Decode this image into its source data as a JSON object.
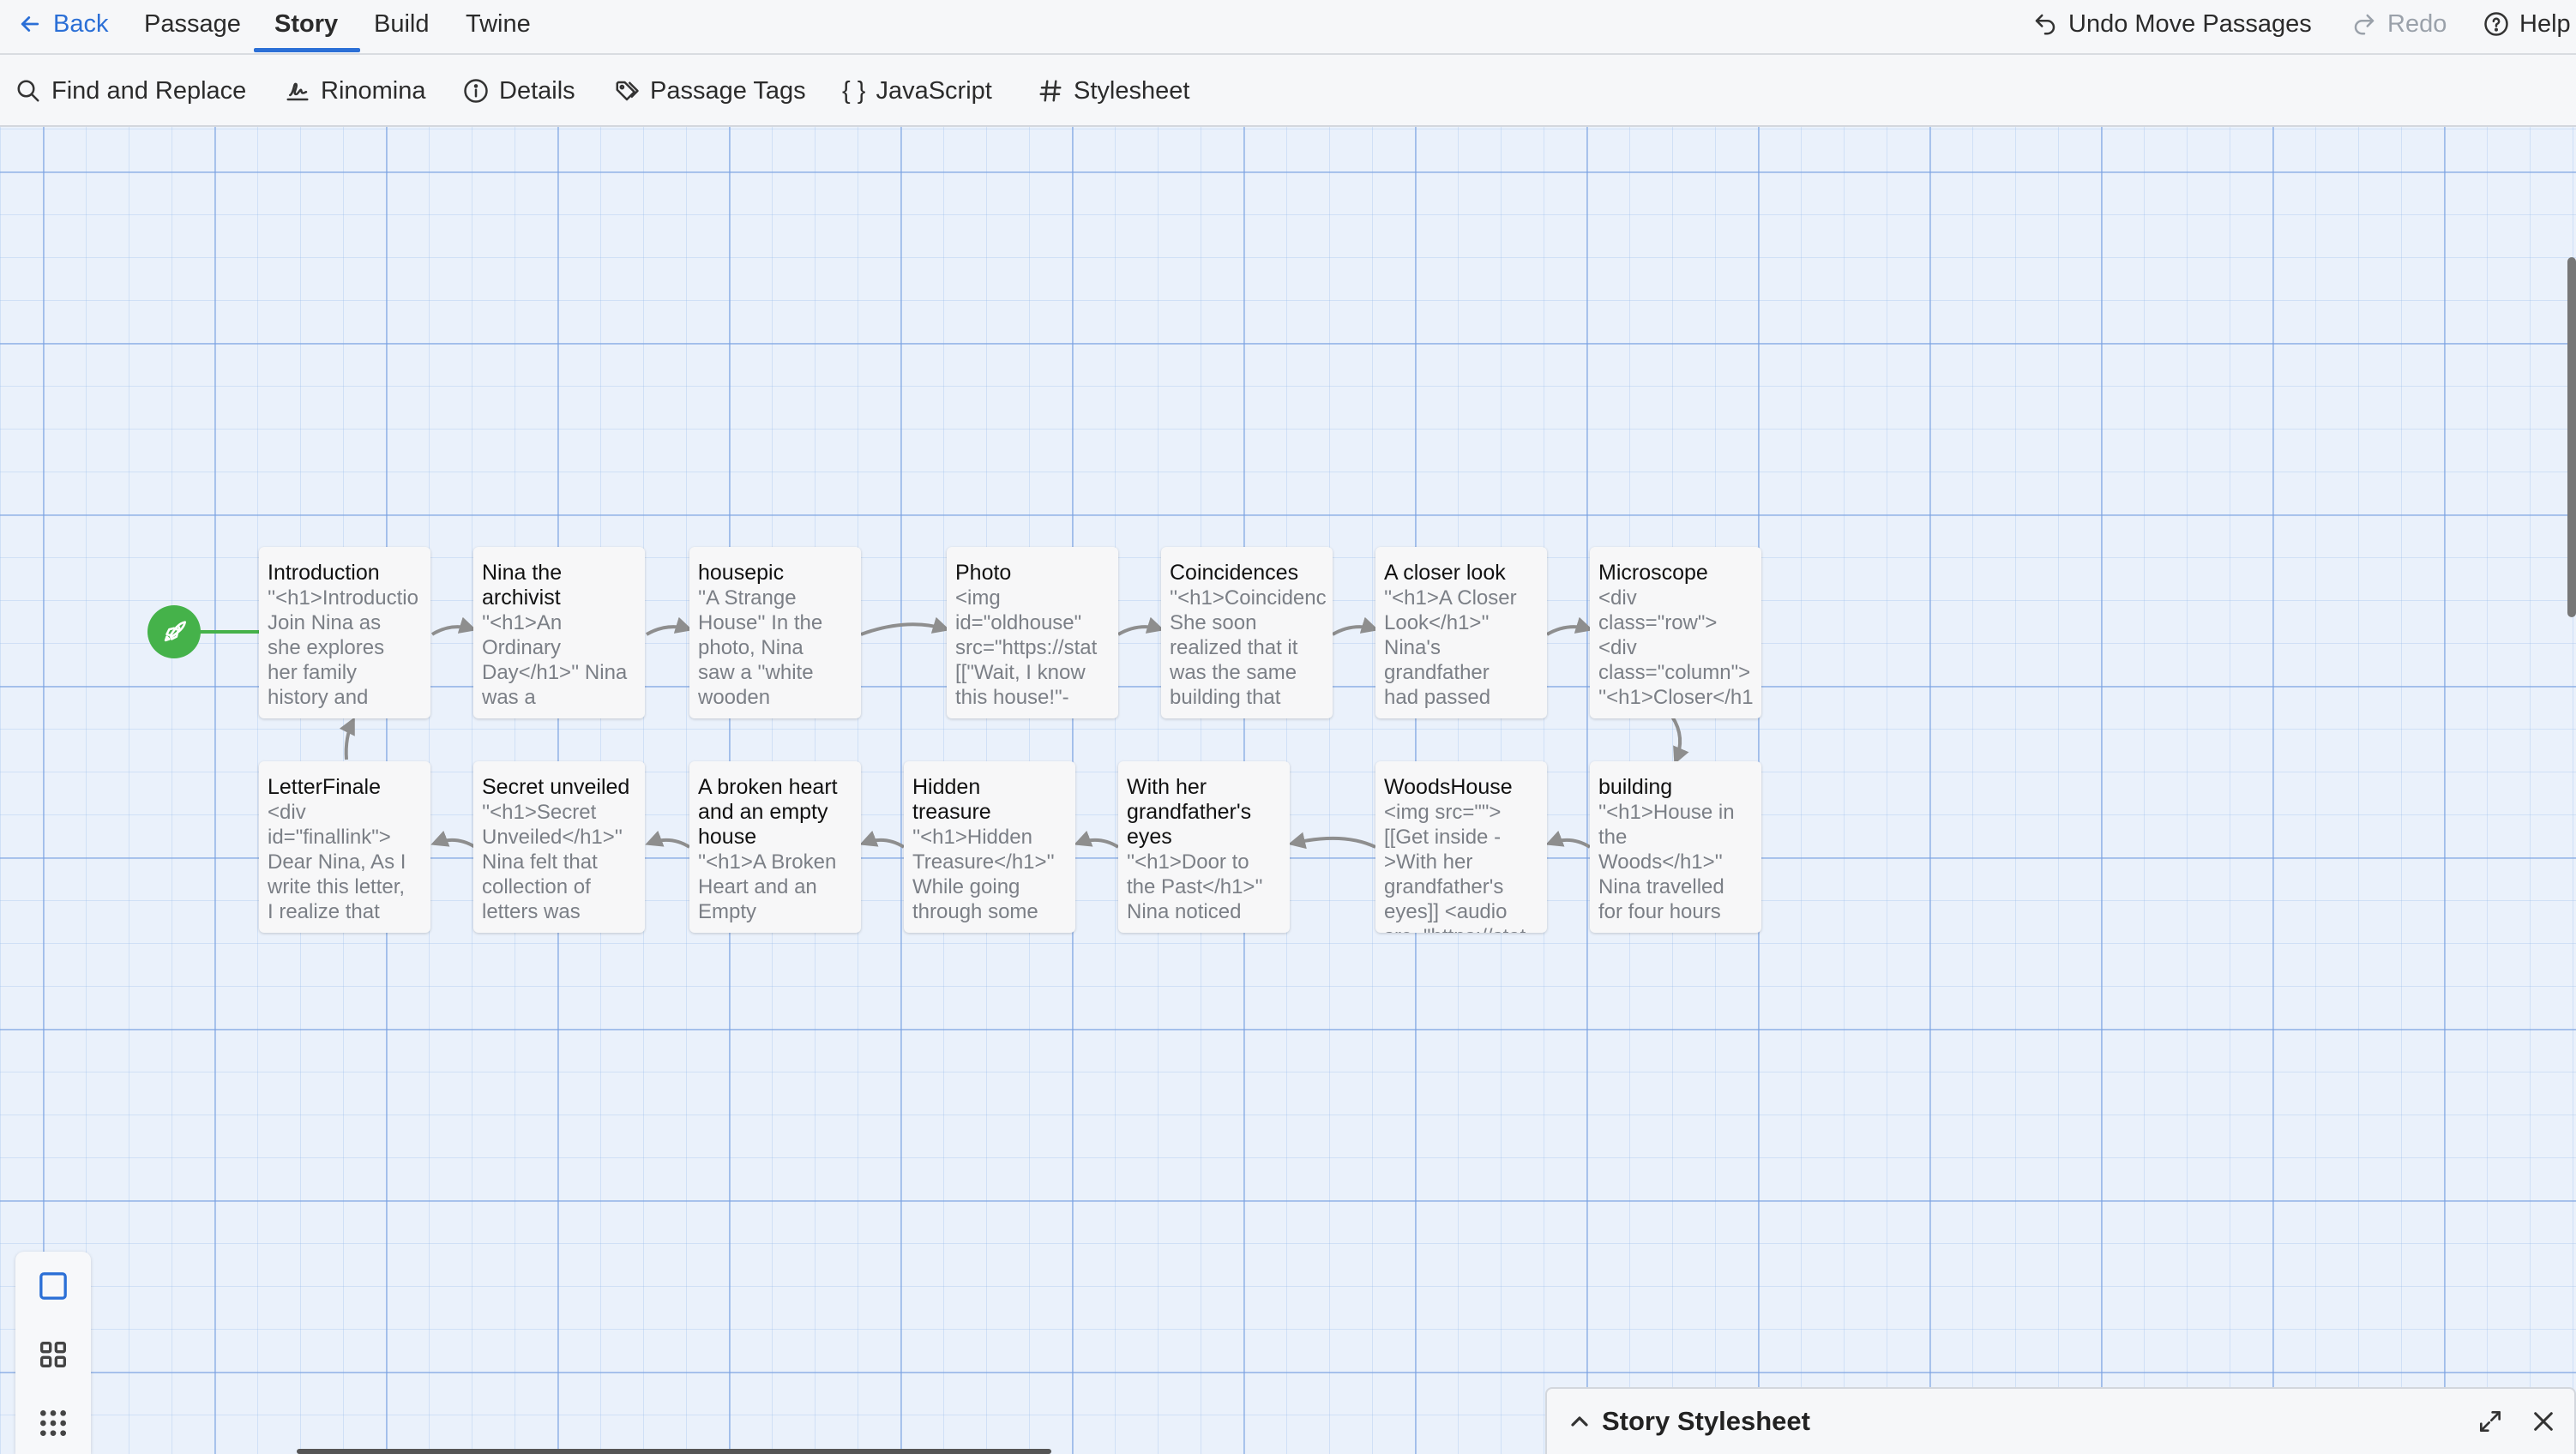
{
  "topbar": {
    "back_label": "Back",
    "tabs": [
      {
        "label": "Passage"
      },
      {
        "label": "Story"
      },
      {
        "label": "Build"
      },
      {
        "label": "Twine"
      }
    ],
    "undo_label": "Undo Move Passages",
    "redo_label": "Redo",
    "help_label": "Help"
  },
  "toolbar": {
    "items": [
      {
        "label": "Find and Replace",
        "icon": "search-icon"
      },
      {
        "label": "Rinomina",
        "icon": "signature-icon"
      },
      {
        "label": "Details",
        "icon": "info-icon"
      },
      {
        "label": "Passage Tags",
        "icon": "tags-icon"
      },
      {
        "label": "{ }",
        "icon": "braces-icon"
      },
      {
        "label": "JavaScript",
        "icon": "braces-icon"
      },
      {
        "label": "Stylesheet",
        "icon": "hash-icon"
      }
    ]
  },
  "passages": [
    {
      "title": "Introduction",
      "excerpt": "''<h1>Introductio\nJoin Nina as\nshe explores\nher family\nhistory and"
    },
    {
      "title": "Nina the\narchivist",
      "excerpt": "''<h1>An\nOrdinary\nDay</h1>'' Nina\nwas a"
    },
    {
      "title": "housepic",
      "excerpt": "''A Strange\nHouse'' In the\nphoto, Nina\nsaw a ''white\nwooden"
    },
    {
      "title": "Photo",
      "excerpt": "<img\nid=\"oldhouse\"\nsrc=\"https://stat\n[[\"Wait, I know\nthis house!\"-"
    },
    {
      "title": "Coincidences",
      "excerpt": "''<h1>Coincidenc\nShe soon\nrealized that it\nwas the same\nbuilding that"
    },
    {
      "title": "A closer look",
      "excerpt": "''<h1>A Closer\nLook</h1>''\nNina's\ngrandfather\nhad passed"
    },
    {
      "title": "Microscope",
      "excerpt": "<div\nclass=\"row\">\n<div\nclass=\"column\">\n''<h1>Closer</h1"
    },
    {
      "title": "LetterFinale",
      "excerpt": "<div\nid=\"finallink\">\nDear Nina, As I\nwrite this letter,\nI realize that"
    },
    {
      "title": "Secret unveiled",
      "excerpt": "''<h1>Secret\nUnveiled</h1>''\nNina felt that\ncollection of\nletters was"
    },
    {
      "title": "A broken heart\nand an empty\nhouse",
      "excerpt": "''<h1>A Broken\nHeart and an\nEmpty"
    },
    {
      "title": "Hidden\ntreasure",
      "excerpt": "''<h1>Hidden\nTreasure</h1>''\nWhile going\nthrough some"
    },
    {
      "title": "With her\ngrandfather's\neyes",
      "excerpt": "''<h1>Door to\nthe Past</h1>''\nNina noticed"
    },
    {
      "title": "WoodsHouse",
      "excerpt": "<img src=\"\">\n[[Get inside -\n>With her\ngrandfather's\neyes]] <audio\nsrc=\"https://stat"
    },
    {
      "title": "building",
      "excerpt": "''<h1>House in\nthe\nWoods</h1>''\nNina travelled\nfor four hours"
    }
  ],
  "stylesheet_panel": {
    "title": "Story Stylesheet"
  },
  "colors": {
    "accent": "#2b6fd6",
    "start": "#45b24a",
    "canvas": "#eaf1fb",
    "arrow": "#8e8e8e"
  }
}
